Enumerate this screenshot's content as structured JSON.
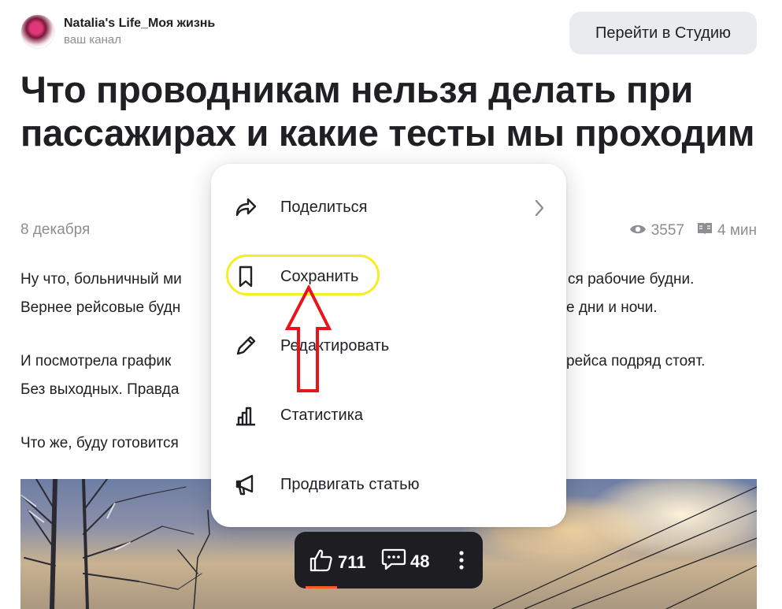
{
  "channel": {
    "name": "Natalia's Life_Моя жизнь",
    "subtitle": "ваш канал"
  },
  "header": {
    "studio_button": "Перейти в Студию"
  },
  "article": {
    "title": "Что проводникам нельзя делать при пассажирах и какие тесты мы проходим",
    "date": "8 декабря",
    "views": "3557",
    "read_time": "4 мин",
    "paragraphs_left": [
      "Ну что, больничный ми",
      "Вернее рейсовые будн",
      "И посмотрела график",
      "Без выходных. Правда",
      "Что же, буду готовится"
    ],
    "paragraphs_right": [
      "ся рабочие будни.",
      "е дни и ночи.",
      "рейса подряд стоят."
    ]
  },
  "menu": {
    "items": [
      {
        "label": "Поделиться",
        "icon": "share-icon",
        "has_submenu": true
      },
      {
        "label": "Сохранить",
        "icon": "bookmark-icon",
        "has_submenu": false
      },
      {
        "label": "Редактировать",
        "icon": "pencil-icon",
        "has_submenu": false
      },
      {
        "label": "Статистика",
        "icon": "bar-chart-icon",
        "has_submenu": false
      },
      {
        "label": "Продвигать статью",
        "icon": "megaphone-icon",
        "has_submenu": false
      }
    ]
  },
  "actions": {
    "likes": "711",
    "comments": "48"
  },
  "annotation": {
    "highlight_color": "#f5ee21",
    "arrow_color": "#e8141b"
  }
}
